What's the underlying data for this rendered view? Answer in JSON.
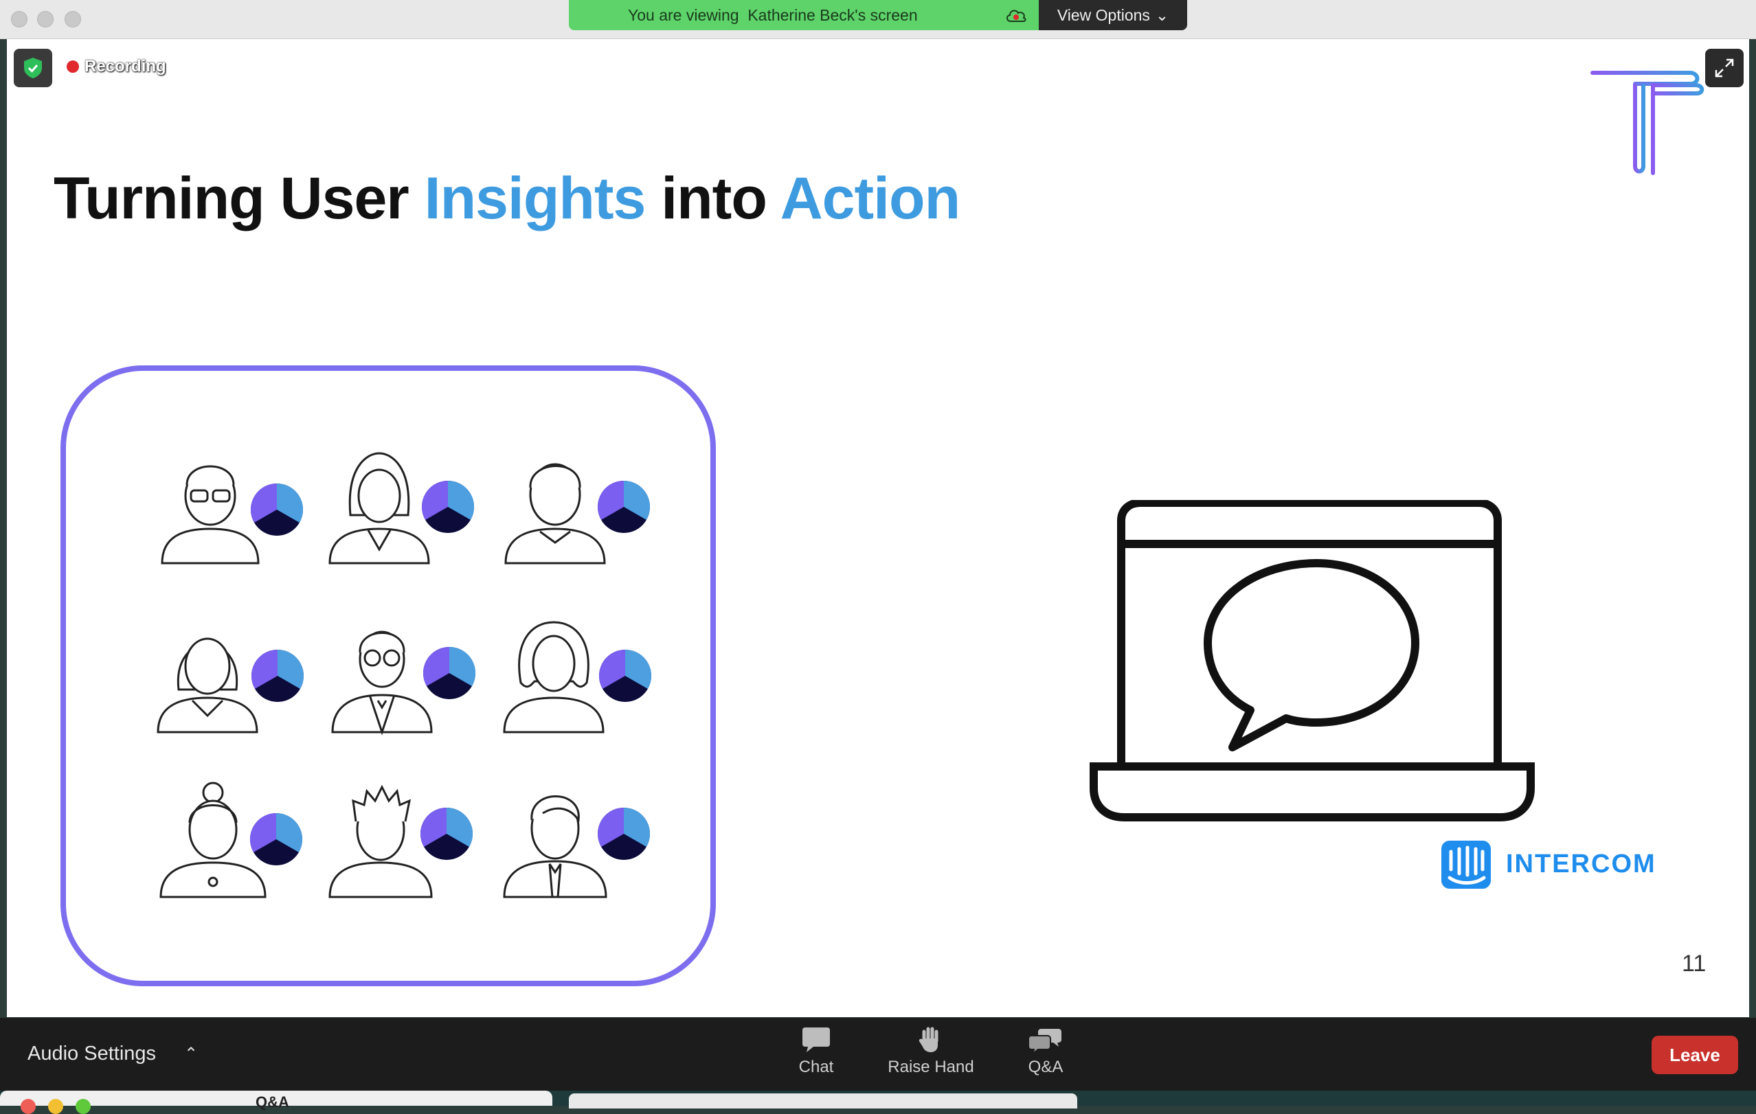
{
  "share_banner": {
    "text": "You are viewing  Katherine Beck's screen",
    "view_options_label": "View Options"
  },
  "recording": {
    "label": "Recording"
  },
  "slide": {
    "title_part1": "Turning User ",
    "title_accent1": "Insights",
    "title_part2": " into ",
    "title_accent2": "Action",
    "brand_label": "INTERCOM",
    "page_number": "11"
  },
  "toolbar": {
    "audio_settings_label": "Audio Settings",
    "chat_label": "Chat",
    "raise_hand_label": "Raise Hand",
    "qa_label": "Q&A",
    "leave_label": "Leave"
  },
  "qa_window": {
    "title": "Q&A"
  },
  "colors": {
    "banner_green": "#5dd36a",
    "accent_blue": "#3e9be0",
    "box_purple": "#7d6ef0",
    "leave_red": "#c8312c",
    "intercom_blue": "#1f8ded"
  }
}
